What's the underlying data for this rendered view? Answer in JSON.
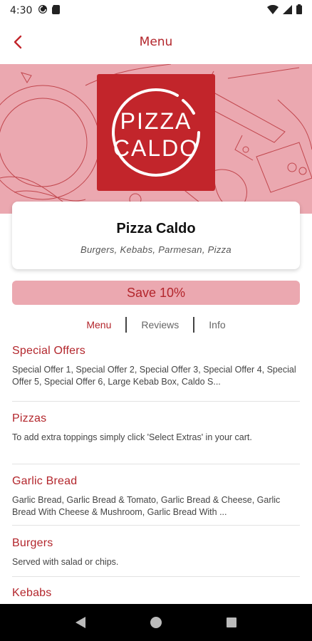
{
  "status": {
    "time": "4:30"
  },
  "header": {
    "title": "Menu"
  },
  "restaurant": {
    "name": "Pizza Caldo",
    "cuisines": "Burgers, Kebabs, Parmesan, Pizza",
    "logo_line1": "PIZZA",
    "logo_line2": "CALDO"
  },
  "promo": {
    "label": "Save 10%"
  },
  "tabs": [
    {
      "label": "Menu"
    },
    {
      "label": "Reviews"
    },
    {
      "label": "Info"
    }
  ],
  "sections": [
    {
      "title": "Special Offers",
      "description": "Special Offer 1, Special Offer 2, Special Offer 3, Special Offer 4, Special Offer 5, Special Offer 6, Large Kebab Box, Caldo S..."
    },
    {
      "title": "Pizzas",
      "description": "To add extra toppings simply click 'Select Extras' in your cart."
    },
    {
      "title": "Garlic Bread",
      "description": "Garlic Bread, Garlic Bread & Tomato, Garlic Bread & Cheese, Garlic Bread With Cheese & Mushroom, Garlic Bread With ..."
    },
    {
      "title": "Burgers",
      "description": "Served with salad or chips."
    },
    {
      "title": "Kebabs",
      "description": ""
    }
  ],
  "colors": {
    "brand": "#b3262c",
    "hero": "#eba8b0"
  }
}
